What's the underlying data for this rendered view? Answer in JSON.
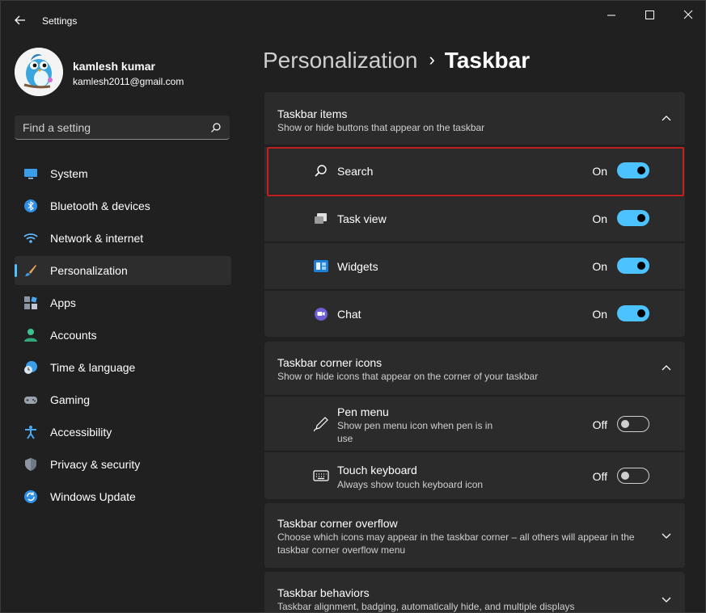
{
  "window": {
    "title": "Settings"
  },
  "profile": {
    "name": "kamlesh kumar",
    "email": "kamlesh2011@gmail.com"
  },
  "search": {
    "placeholder": "Find a setting"
  },
  "sidebar": {
    "items": [
      {
        "label": "System",
        "icon": "monitor-icon"
      },
      {
        "label": "Bluetooth & devices",
        "icon": "bluetooth-icon"
      },
      {
        "label": "Network & internet",
        "icon": "wifi-icon"
      },
      {
        "label": "Personalization",
        "icon": "brush-icon",
        "active": true
      },
      {
        "label": "Apps",
        "icon": "apps-icon"
      },
      {
        "label": "Accounts",
        "icon": "person-icon"
      },
      {
        "label": "Time & language",
        "icon": "clock-globe-icon"
      },
      {
        "label": "Gaming",
        "icon": "gamepad-icon"
      },
      {
        "label": "Accessibility",
        "icon": "accessibility-icon"
      },
      {
        "label": "Privacy & security",
        "icon": "shield-icon"
      },
      {
        "label": "Windows Update",
        "icon": "update-icon"
      }
    ]
  },
  "breadcrumb": {
    "parent": "Personalization",
    "separator": "›",
    "current": "Taskbar"
  },
  "taskbar_items": {
    "title": "Taskbar items",
    "subtitle": "Show or hide buttons that appear on the taskbar",
    "rows": [
      {
        "label": "Search",
        "state": "On",
        "on": true,
        "icon": "search-icon"
      },
      {
        "label": "Task view",
        "state": "On",
        "on": true,
        "icon": "task-view-icon"
      },
      {
        "label": "Widgets",
        "state": "On",
        "on": true,
        "icon": "widgets-icon"
      },
      {
        "label": "Chat",
        "state": "On",
        "on": true,
        "icon": "chat-icon"
      }
    ]
  },
  "corner_icons": {
    "title": "Taskbar corner icons",
    "subtitle": "Show or hide icons that appear on the corner of your taskbar",
    "rows": [
      {
        "label": "Pen menu",
        "sub1": "Show pen menu icon when pen is in",
        "sub2": "use",
        "state": "Off",
        "on": false,
        "icon": "pen-icon"
      },
      {
        "label": "Touch keyboard",
        "sub1": "Always show touch keyboard icon",
        "state": "Off",
        "on": false,
        "icon": "keyboard-icon"
      }
    ]
  },
  "corner_overflow": {
    "title": "Taskbar corner overflow",
    "line1": "Choose which icons may appear in the taskbar corner – all others will appear in the",
    "line2": "taskbar corner overflow menu"
  },
  "behaviors": {
    "title": "Taskbar behaviors",
    "subtitle": "Taskbar alignment, badging, automatically hide, and multiple displays"
  },
  "colors": {
    "accent": "#4cc2ff",
    "highlight": "#c0211e",
    "background": "#202020",
    "card": "#2b2b2b"
  }
}
